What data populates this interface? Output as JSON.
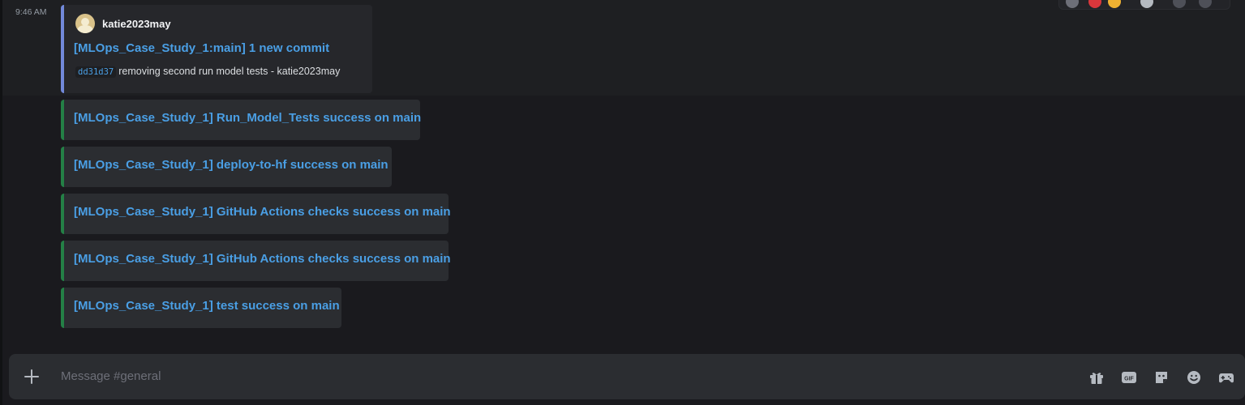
{
  "message": {
    "timestamp": "9:46 AM",
    "commit_embed": {
      "author": "katie2023may",
      "title": "[MLOps_Case_Study_1:main] 1 new commit",
      "commit_hash": "dd31d37",
      "commit_text": "removing second run model tests - katie2023may",
      "accent_color": "#7289da"
    },
    "status_embeds": [
      {
        "title": "[MLOps_Case_Study_1] Run_Model_Tests success on main"
      },
      {
        "title": "[MLOps_Case_Study_1] deploy-to-hf success on main"
      },
      {
        "title": "[MLOps_Case_Study_1] GitHub Actions checks success on main"
      },
      {
        "title": "[MLOps_Case_Study_1] GitHub Actions checks success on main"
      },
      {
        "title": "[MLOps_Case_Study_1] test success on main"
      }
    ],
    "status_accent_color": "#248046",
    "link_color": "#4a9fe5"
  },
  "composer": {
    "placeholder": "Message #general",
    "icons": [
      "plus-icon",
      "gift-icon",
      "gif-icon",
      "sticker-icon",
      "emoji-icon",
      "apps-icon"
    ]
  }
}
